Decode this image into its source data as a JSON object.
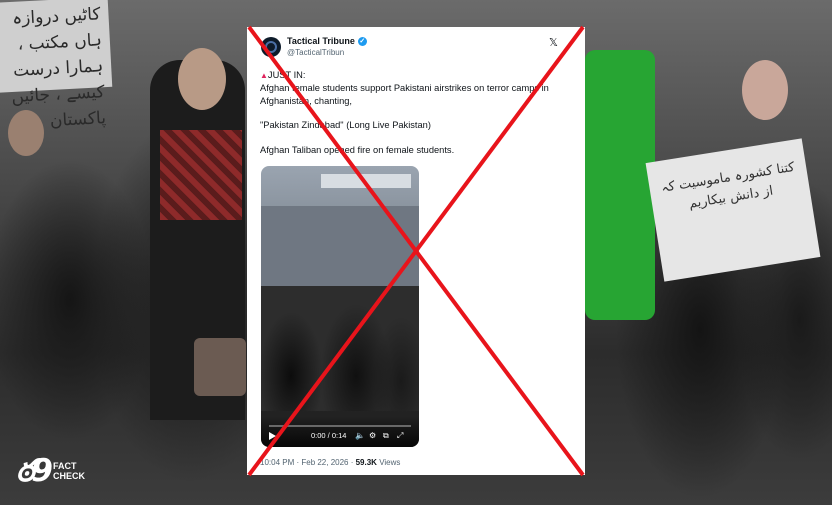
{
  "background": {
    "sign_left_text": "کاٹیں دروازہ ہاں مکتب ، ہمارا درست کیسے ، جائیں پاکستان",
    "sign_right_text": "کتنا کشورہ ماموسیت کہ از دانش بیکاریم"
  },
  "watermark": {
    "mark": "ఠ9",
    "line1": "FACT",
    "line2": "CHECK"
  },
  "tweet": {
    "author_name": "Tactical Tribune",
    "handle": "@TacticalTribun",
    "verified_icon": "verified-badge-icon",
    "line1_prefix": "▲",
    "line1": "JUST IN:",
    "line2": "Afghan female students support Pakistani airstrikes on terror camps in Afghanistan, chanting,",
    "line3": "\"Pakistan Zindabad\" (Long Live Pakistan)",
    "line4": "Afghan Taliban opened fire on female students.",
    "video": {
      "time": "0:00 / 0:14",
      "play_icon": "play-icon",
      "progress": 0.0
    },
    "timestamp": "10:04 PM · Feb 22, 2026 · ",
    "views_count": "59.3K",
    "views_label": " Views"
  },
  "colors": {
    "cross": "#e8141b",
    "verified": "#1d9bf0",
    "green_clothing": "#27a533"
  }
}
